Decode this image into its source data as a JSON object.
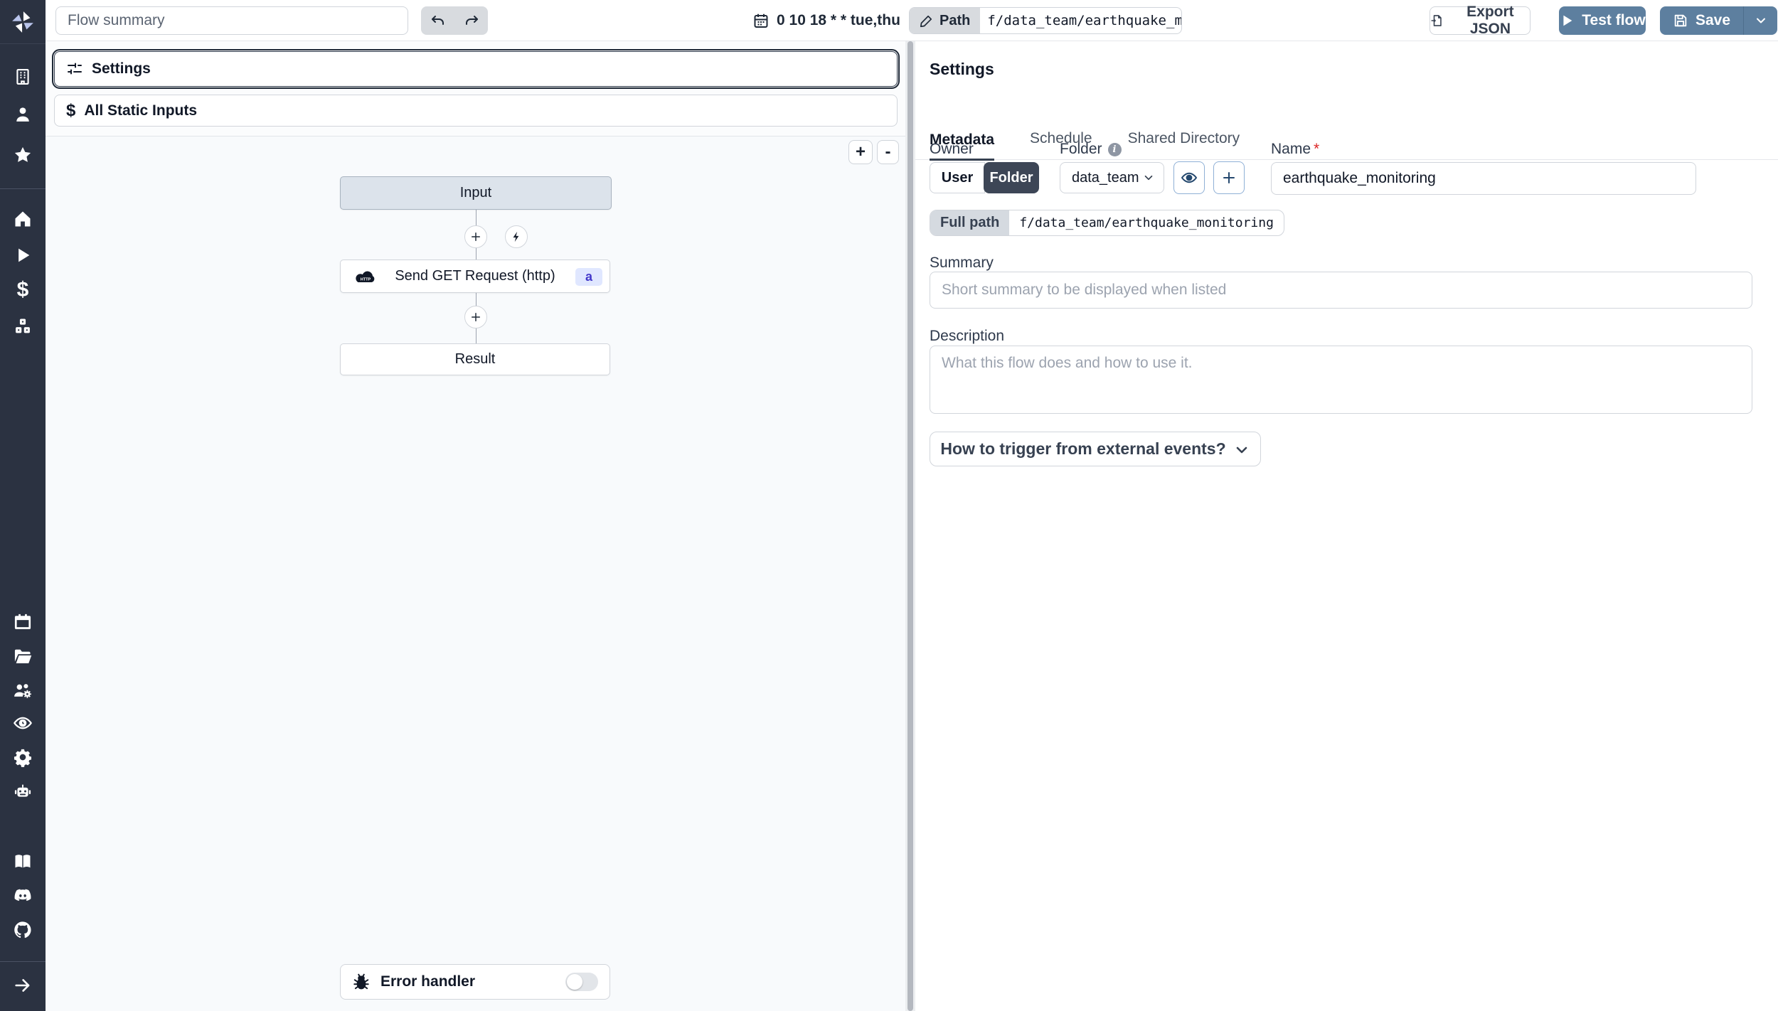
{
  "colors": {
    "accent_blue": "#5d7f9f",
    "sidebar_bg": "#2b3241",
    "badge_bg": "#e0e7ff",
    "badge_text": "#4338ca",
    "required_red": "#dc2626",
    "canvas_bg": "#f8fafc",
    "input_node_bg": "#dce3eb"
  },
  "topbar": {
    "flow_summary_placeholder": "Flow summary",
    "cron": "0 10 18 * * tue,thu",
    "path_label": "Path",
    "path_value": "f/data_team/earthquake_monit",
    "export_json": "Export JSON",
    "test_flow": "Test flow",
    "save": "Save"
  },
  "flow": {
    "settings_row": "Settings",
    "static_inputs_row": "All Static Inputs",
    "zoom_in": "+",
    "zoom_out": "-",
    "input_node": "Input",
    "http_node": "Send GET Request (http)",
    "http_node_badge": "a",
    "http_icon_text": "HTTP",
    "result_node": "Result",
    "error_handler": "Error handler"
  },
  "panel": {
    "title": "Settings",
    "tabs": [
      {
        "label": "Metadata"
      },
      {
        "label": "Schedule"
      },
      {
        "label": "Shared Directory"
      }
    ],
    "owner_label": "Owner",
    "owner_user": "User",
    "owner_folder": "Folder",
    "folder_label": "Folder",
    "folder_info": "i",
    "folder_value": "data_team",
    "name_label": "Name",
    "name_required": "*",
    "name_value": "earthquake_monitoring",
    "full_path_label": "Full path",
    "full_path_value": "f/data_team/earthquake_monitoring",
    "summary_label": "Summary",
    "summary_placeholder": "Short summary to be displayed when listed",
    "description_label": "Description",
    "description_placeholder": "What this flow does and how to use it.",
    "trigger_question": "How to trigger from external events?"
  },
  "sidebar": {
    "icons": [
      "windmill-logo",
      "building-icon",
      "user-icon",
      "star-icon",
      "home-icon",
      "play-icon",
      "dollar-icon",
      "resources-icon",
      "calendar-icon",
      "folder-open-icon",
      "groups-icon",
      "audit-eye-icon",
      "gear-icon",
      "robot-icon",
      "book-icon",
      "discord-icon",
      "github-icon",
      "expand-arrow-icon"
    ]
  }
}
